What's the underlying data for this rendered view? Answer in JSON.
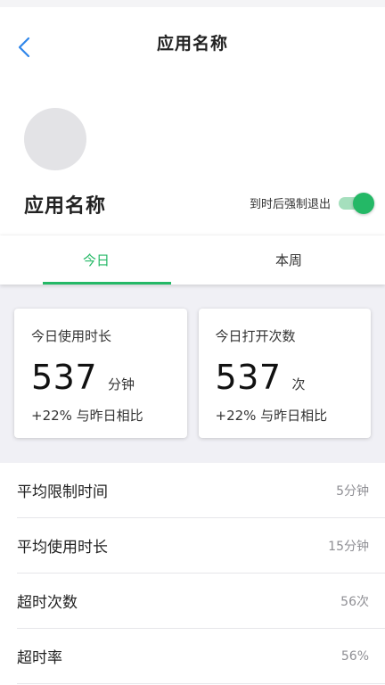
{
  "nav": {
    "title": "应用名称"
  },
  "app": {
    "name": "应用名称"
  },
  "force_quit": {
    "label": "到时后强制退出",
    "enabled": true
  },
  "tabs": [
    {
      "label": "今日",
      "active": true
    },
    {
      "label": "本周",
      "active": false
    }
  ],
  "cards": [
    {
      "title": "今日使用时长",
      "value": "537",
      "unit": "分钟",
      "compare": "+22% 与昨日相比"
    },
    {
      "title": "今日打开次数",
      "value": "537",
      "unit": "次",
      "compare": "+22% 与昨日相比"
    }
  ],
  "stats": [
    {
      "label": "平均限制时间",
      "value": "5分钟"
    },
    {
      "label": "平均使用时长",
      "value": "15分钟"
    },
    {
      "label": "超时次数",
      "value": "56次"
    },
    {
      "label": "超时率",
      "value": "56%"
    }
  ],
  "colors": {
    "accent": "#24b866",
    "accent_light": "#a5dfbd",
    "back_icon": "#2f86ea"
  },
  "icons": {
    "back": "chevron-left-icon"
  }
}
